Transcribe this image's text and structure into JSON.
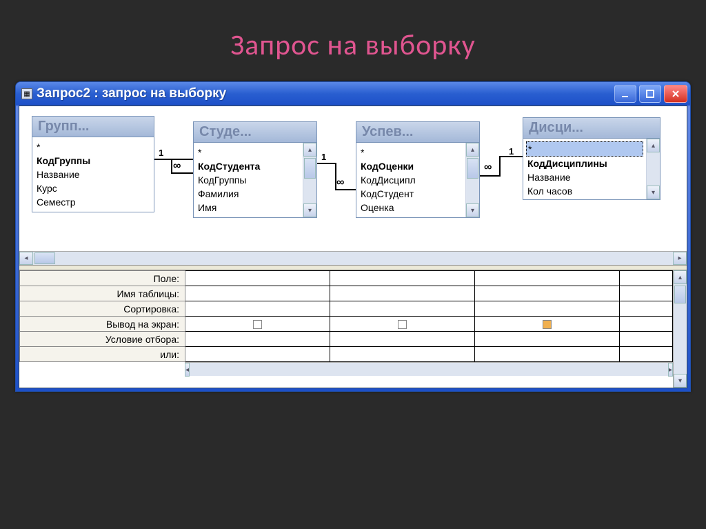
{
  "slide_title": "Запрос на выборку",
  "window": {
    "title": "Запрос2 : запрос на выборку"
  },
  "tables": [
    {
      "header": "Групп...",
      "fields": [
        "*",
        "КодГруппы",
        "Название",
        "Курс",
        "Семестр"
      ],
      "bold_index": 1,
      "selected_index": -1
    },
    {
      "header": "Студе...",
      "fields": [
        "*",
        "КодСтудента",
        "КодГруппы",
        "Фамилия",
        "Имя"
      ],
      "bold_index": 1,
      "selected_index": -1
    },
    {
      "header": "Успев...",
      "fields": [
        "*",
        "КодОценки",
        "КодДисципл",
        "КодСтудент",
        "Оценка"
      ],
      "bold_index": 1,
      "selected_index": -1
    },
    {
      "header": "Дисци...",
      "fields": [
        "*",
        "КодДисциплины",
        "Название",
        "Кол часов"
      ],
      "bold_index": 1,
      "selected_index": 0
    }
  ],
  "relations": {
    "one": "1",
    "many": "∞"
  },
  "grid": {
    "rows": [
      "Поле:",
      "Имя таблицы:",
      "Сортировка:",
      "Вывод на экран:",
      "Условие отбора:",
      "или:"
    ]
  }
}
